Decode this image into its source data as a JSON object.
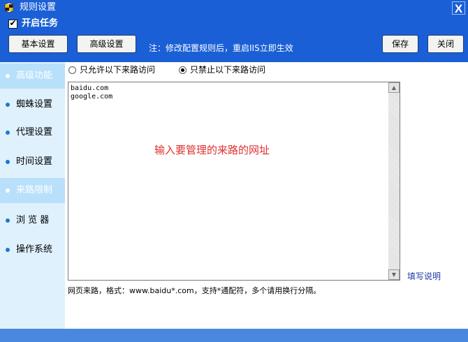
{
  "window": {
    "title": "规则设置",
    "close_label": "X"
  },
  "toolbar": {
    "enable_task_label": "开启任务",
    "enable_task_checked": true,
    "basic_settings_label": "基本设置",
    "advanced_settings_label": "高级设置",
    "note": "注：修改配置规则后，重启IIS立即生效",
    "save_label": "保存",
    "close_label": "关闭"
  },
  "sidebar": {
    "items": [
      {
        "label": "高级功能",
        "selected": true
      },
      {
        "label": "蜘蛛设置",
        "selected": false
      },
      {
        "label": "代理设置",
        "selected": false
      },
      {
        "label": "时间设置",
        "selected": false
      },
      {
        "label": "来路限制",
        "selected": true
      },
      {
        "label": "浏 览 器",
        "selected": false
      },
      {
        "label": "操作系统",
        "selected": false
      }
    ]
  },
  "main": {
    "radio_allow_label": "只允许以下来路访问",
    "radio_deny_label": "只禁止以下来路访问",
    "selected_radio": "deny",
    "referrers": [
      "baidu.com",
      "google.com"
    ],
    "hint": "输入要管理的来路的网址",
    "help_link": "填写说明",
    "format_note": "网页来路，格式：www.baidu*.com，支持*通配符，多个请用换行分隔。"
  }
}
